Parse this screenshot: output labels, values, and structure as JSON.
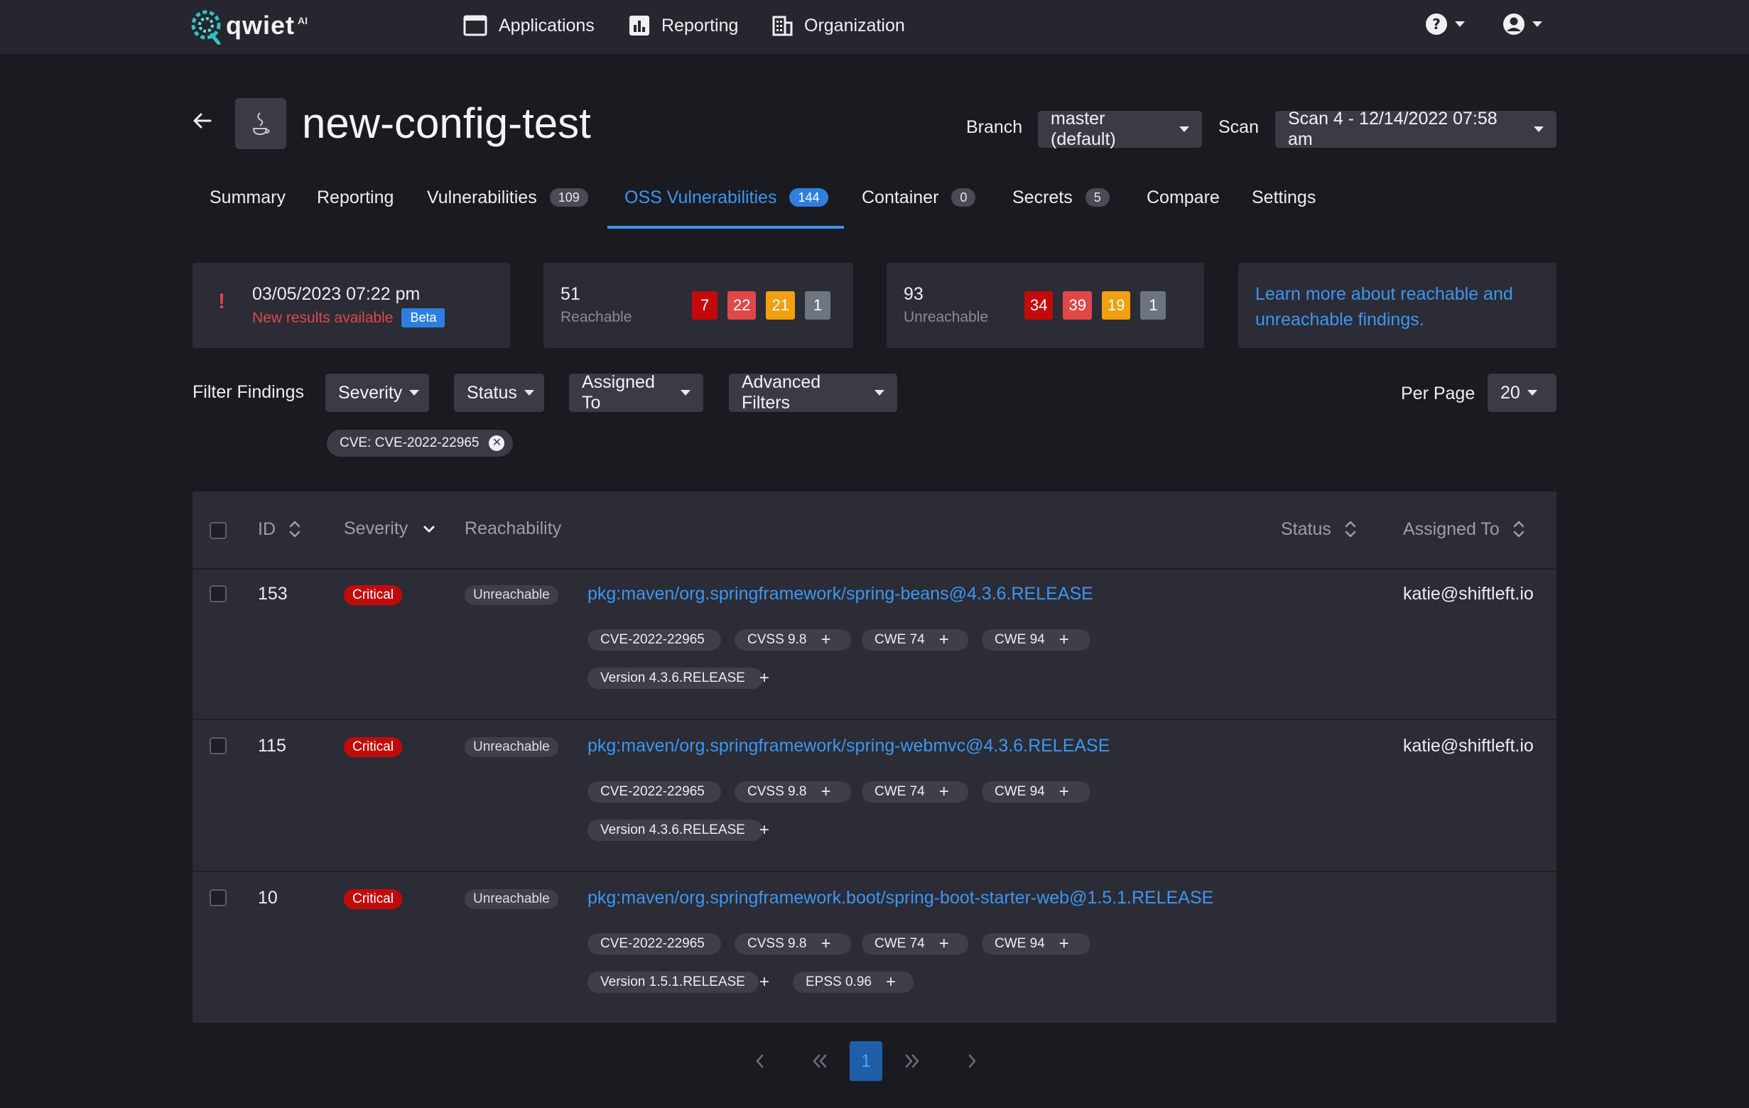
{
  "nav": {
    "logo_text": "qwiet",
    "logo_suffix": "AI",
    "applications": "Applications",
    "reporting": "Reporting",
    "organization": "Organization"
  },
  "header": {
    "title": "new-config-test",
    "branch_label": "Branch",
    "branch_value": "master (default)",
    "scan_label": "Scan",
    "scan_value": "Scan 4 - 12/14/2022 07:58 am"
  },
  "tabs": [
    {
      "label": "Summary"
    },
    {
      "label": "Reporting"
    },
    {
      "label": "Vulnerabilities",
      "count": "109"
    },
    {
      "label": "OSS Vulnerabilities",
      "count": "144"
    },
    {
      "label": "Container",
      "count": "0"
    },
    {
      "label": "Secrets",
      "count": "5"
    },
    {
      "label": "Compare"
    },
    {
      "label": "Settings"
    }
  ],
  "cards": {
    "alert": {
      "date": "03/05/2023 07:22 pm",
      "message": "New results available",
      "badge": "Beta"
    },
    "reachable": {
      "count": "51",
      "label": "Reachable",
      "critical": "7",
      "high": "22",
      "medium": "21",
      "low": "1"
    },
    "unreachable": {
      "count": "93",
      "label": "Unreachable",
      "critical": "34",
      "high": "39",
      "medium": "19",
      "low": "1"
    },
    "learn": {
      "line1": "Learn more about reachable and",
      "line2": "unreachable findings."
    }
  },
  "filters": {
    "label": "Filter Findings",
    "severity": "Severity",
    "status": "Status",
    "assigned_to": "Assigned To",
    "advanced": "Advanced Filters",
    "per_page_label": "Per Page",
    "per_page_value": "20",
    "active_chip": "CVE: CVE-2022-22965"
  },
  "table": {
    "headers": {
      "id": "ID",
      "severity": "Severity",
      "reachability": "Reachability",
      "status": "Status",
      "assigned_to": "Assigned To"
    },
    "rows": [
      {
        "id": "153",
        "severity": "Critical",
        "reachability": "Unreachable",
        "package": "pkg:maven/org.springframework/spring-beans@4.3.6.RELEASE",
        "cve": "CVE-2022-22965",
        "cvss": "CVSS 9.8",
        "cwe1": "CWE 74",
        "cwe2": "CWE 94",
        "version": "Version 4.3.6.RELEASE",
        "epss": "",
        "assignee": "katie@shiftleft.io"
      },
      {
        "id": "115",
        "severity": "Critical",
        "reachability": "Unreachable",
        "package": "pkg:maven/org.springframework/spring-webmvc@4.3.6.RELEASE",
        "cve": "CVE-2022-22965",
        "cvss": "CVSS 9.8",
        "cwe1": "CWE 74",
        "cwe2": "CWE 94",
        "version": "Version 4.3.6.RELEASE",
        "epss": "",
        "assignee": "katie@shiftleft.io"
      },
      {
        "id": "10",
        "severity": "Critical",
        "reachability": "Unreachable",
        "package": "pkg:maven/org.springframework.boot/spring-boot-starter-web@1.5.1.RELEASE",
        "cve": "CVE-2022-22965",
        "cvss": "CVSS 9.8",
        "cwe1": "CWE 74",
        "cwe2": "CWE 94",
        "version": "Version 1.5.1.RELEASE",
        "epss": "EPSS 0.96",
        "assignee": ""
      }
    ]
  },
  "pagination": {
    "current": "1"
  },
  "colors": {
    "accent": "#3d96f2",
    "critical": "#c30a0a",
    "high": "#e04848",
    "medium": "#f0a010",
    "low": "#6d7680"
  }
}
